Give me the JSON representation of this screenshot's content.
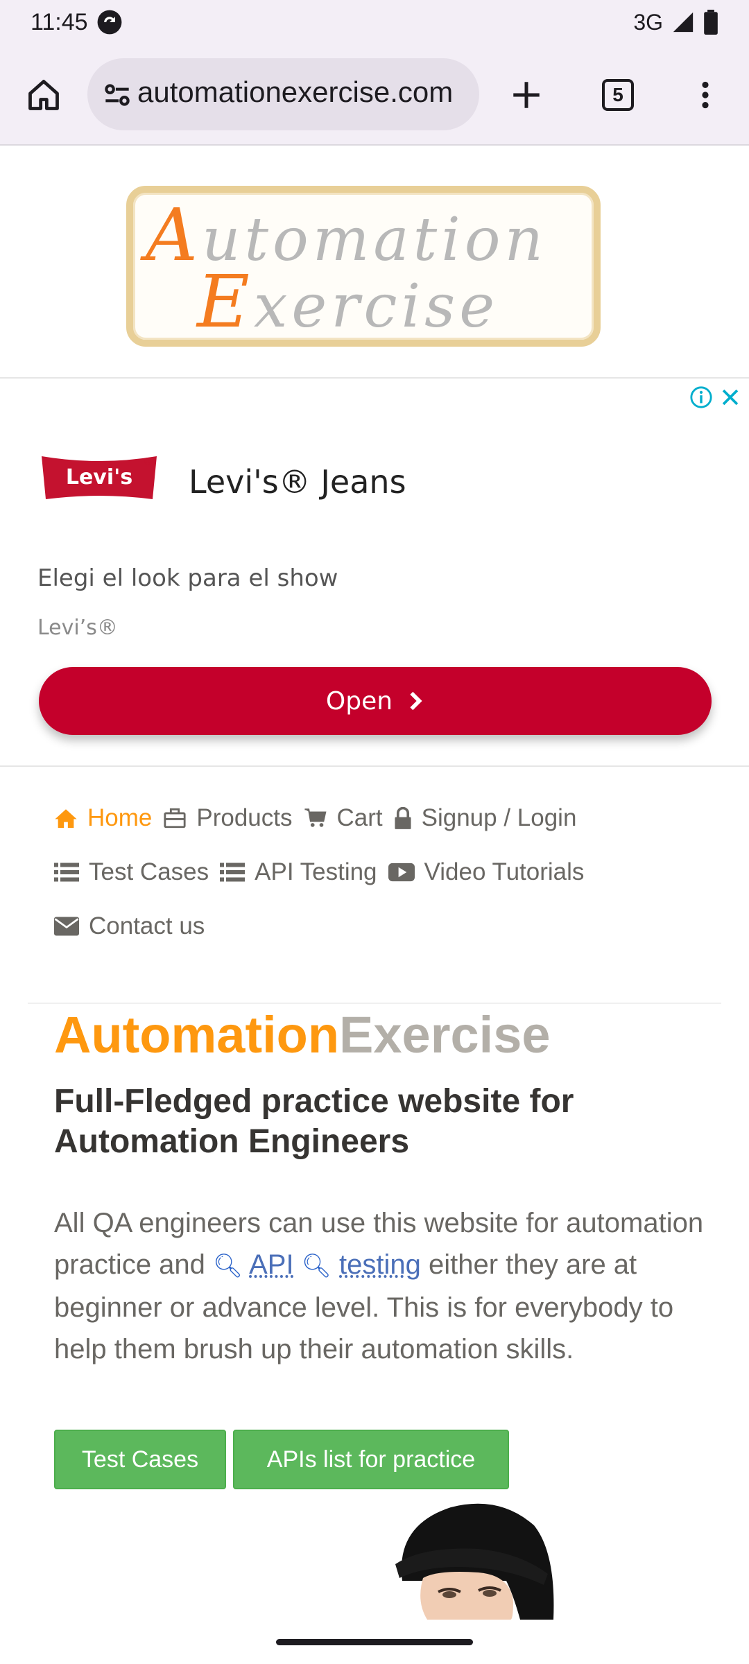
{
  "status_bar": {
    "time": "11:45",
    "network": "3G"
  },
  "browser": {
    "url": "automationexercise.com",
    "tab_count": "5"
  },
  "logo": {
    "line1_cap": "A",
    "line1_rest": "utomation",
    "line2_cap": "E",
    "line2_rest": "xercise"
  },
  "ad": {
    "brand_logo_text": "Levi's",
    "title": "Levi's® Jeans",
    "description": "Elegi el look para el show",
    "advertiser": "Levi’s®",
    "cta": "Open"
  },
  "nav": {
    "home": "Home",
    "products": "Products",
    "cart": "Cart",
    "signup": "Signup / Login",
    "test_cases": "Test Cases",
    "api_testing": "API Testing",
    "video_tutorials": "Video Tutorials",
    "contact": "Contact us"
  },
  "hero": {
    "title_a": "Automation",
    "title_b": "Exercise",
    "subtitle": "Full-Fledged practice website for Automation Engineers",
    "para_1": "All QA engineers can use this website for automation practice and ",
    "link_api": "API",
    "link_testing": "testing",
    "para_2": " either they are at beginner or advance level. This is for everybody to help them brush up their automation skills.",
    "btn_test_cases": "Test Cases",
    "btn_apis": "APIs list for practice"
  },
  "colors": {
    "accent_orange": "#fe980f",
    "ad_red": "#c4002b",
    "green": "#5cb85c"
  }
}
